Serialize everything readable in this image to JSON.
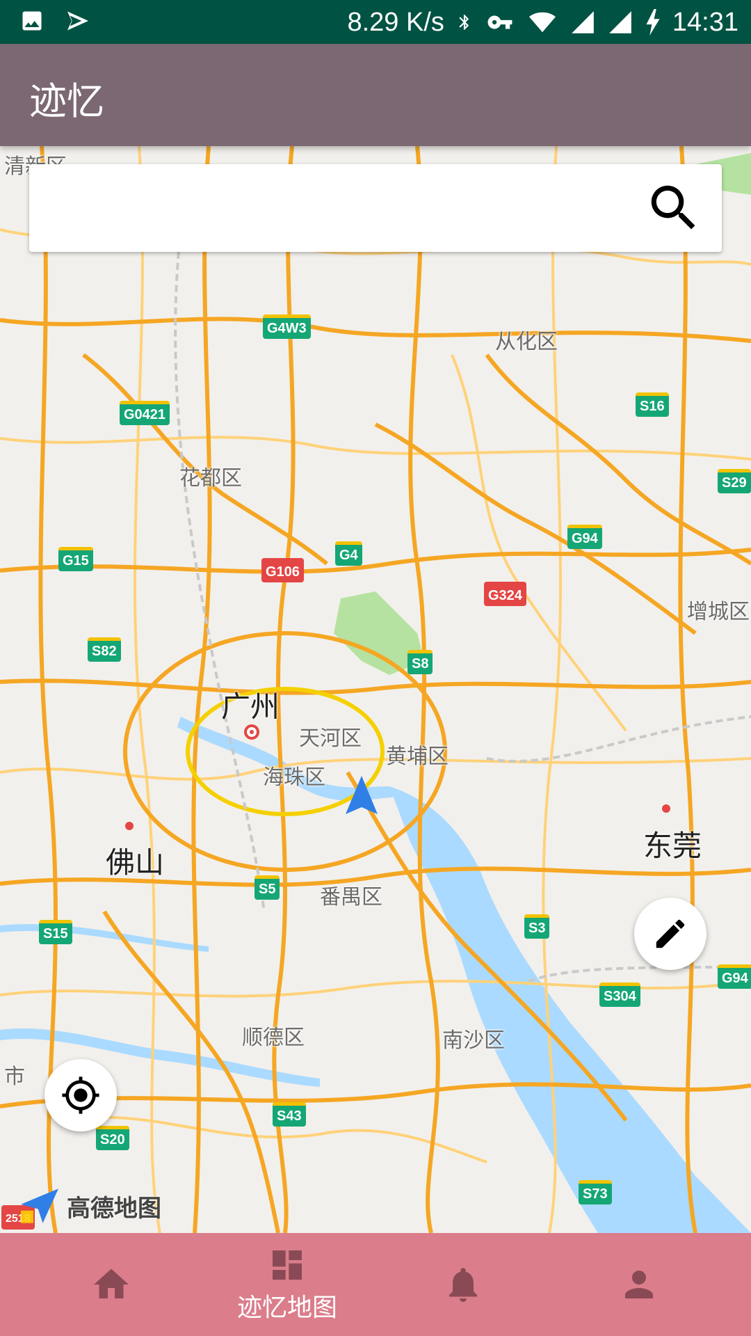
{
  "status_bar": {
    "speed": "8.29 K/s",
    "time": "14:31",
    "icons": [
      "image-icon",
      "send-icon",
      "bluetooth-icon",
      "key-icon",
      "wifi-icon",
      "signal-icon",
      "signal-icon",
      "charging-icon"
    ]
  },
  "app_bar": {
    "title": "迹忆"
  },
  "search": {
    "value": "",
    "placeholder": ""
  },
  "map": {
    "places": [
      {
        "label": "清新区"
      },
      {
        "label": "从化区"
      },
      {
        "label": "花都区"
      },
      {
        "label": "增城区"
      },
      {
        "label": "广州"
      },
      {
        "label": "天河区"
      },
      {
        "label": "黄埔区"
      },
      {
        "label": "海珠区"
      },
      {
        "label": "佛山"
      },
      {
        "label": "东莞"
      },
      {
        "label": "番禺区"
      },
      {
        "label": "顺德区"
      },
      {
        "label": "南沙区"
      },
      {
        "label": "市"
      }
    ],
    "road_shields": [
      "G4W3",
      "G0421",
      "S16",
      "S29",
      "G15",
      "G106",
      "G4",
      "G94",
      "G324",
      "S82",
      "S8",
      "S5",
      "S15",
      "S3",
      "G94",
      "S304",
      "S43",
      "S20",
      "S73",
      "2518"
    ],
    "logo_text": "高德地图"
  },
  "fabs": {
    "edit": "edit-icon",
    "locate": "my-location-icon"
  },
  "bottom_nav": {
    "items": [
      {
        "icon": "home-icon",
        "label": ""
      },
      {
        "icon": "dashboard-icon",
        "label": "迹忆地图"
      },
      {
        "icon": "bell-icon",
        "label": ""
      },
      {
        "icon": "person-icon",
        "label": ""
      }
    ],
    "active_index": 1
  },
  "colors": {
    "status_bar": "#005343",
    "app_bar": "#7b6873",
    "bottom_nav": "#db7d8b",
    "road_major": "#f5a623",
    "road_minor": "#ffd27a",
    "water": "#aadaff",
    "shield_green": "#15a676",
    "shield_red": "#e44545"
  }
}
